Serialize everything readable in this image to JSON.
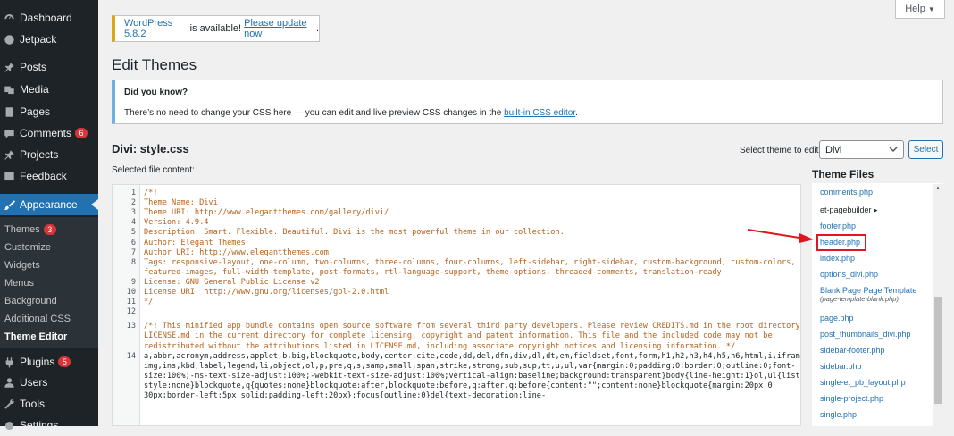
{
  "sidebar": {
    "items": [
      {
        "label": "Dashboard",
        "icon": "dashboard-icon"
      },
      {
        "label": "Jetpack",
        "icon": "jetpack-icon"
      },
      {
        "label": "Posts",
        "icon": "pin-icon"
      },
      {
        "label": "Media",
        "icon": "media-icon"
      },
      {
        "label": "Pages",
        "icon": "pages-icon"
      },
      {
        "label": "Comments",
        "icon": "comment-icon",
        "badge": "6"
      },
      {
        "label": "Projects",
        "icon": "pin-icon"
      },
      {
        "label": "Feedback",
        "icon": "feedback-icon"
      },
      {
        "label": "Appearance",
        "icon": "brush-icon"
      },
      {
        "label": "Plugins",
        "icon": "plugin-icon",
        "badge": "5"
      },
      {
        "label": "Users",
        "icon": "users-icon"
      },
      {
        "label": "Tools",
        "icon": "tools-icon"
      },
      {
        "label": "Settings",
        "icon": "settings-icon"
      }
    ],
    "submenu": [
      {
        "label": "Themes",
        "badge": "3"
      },
      {
        "label": "Customize"
      },
      {
        "label": "Widgets"
      },
      {
        "label": "Menus"
      },
      {
        "label": "Background"
      },
      {
        "label": "Additional CSS"
      },
      {
        "label": "Theme Editor"
      }
    ]
  },
  "help": {
    "label": "Help"
  },
  "notice": {
    "version_text": "WordPress 5.8.2",
    "is_available": " is available! ",
    "link": "Please update now",
    "end": "."
  },
  "page_title": "Edit Themes",
  "did_you_know": {
    "title": "Did you know?",
    "text": "There’s no need to change your CSS here — you can edit and live preview CSS changes in the ",
    "link": "built-in CSS editor",
    "end": "."
  },
  "file_title": "Divi: style.css",
  "selected_label": "Selected file content:",
  "theme_select": {
    "label": "Select theme to edit: ",
    "value": "Divi",
    "button": "Select"
  },
  "editor": {
    "lines": [
      {
        "n": "1",
        "text": "/*!"
      },
      {
        "n": "2",
        "text": "Theme Name: Divi"
      },
      {
        "n": "3",
        "text": "Theme URI: http://www.elegantthemes.com/gallery/divi/"
      },
      {
        "n": "4",
        "text": "Version: 4.9.4"
      },
      {
        "n": "5",
        "text": "Description: Smart. Flexible. Beautiful. Divi is the most powerful theme in our collection."
      },
      {
        "n": "6",
        "text": "Author: Elegant Themes"
      },
      {
        "n": "7",
        "text": "Author URI: http://www.elegantthemes.com"
      },
      {
        "n": "8",
        "text": "Tags: responsive-layout, one-column, two-columns, three-columns, four-columns, left-sidebar, right-sidebar, custom-background, custom-colors,"
      },
      {
        "n": "",
        "text": "featured-images, full-width-template, post-formats, rtl-language-support, theme-options, threaded-comments, translation-ready"
      },
      {
        "n": "9",
        "text": "License: GNU General Public License v2"
      },
      {
        "n": "10",
        "text": "License URI: http://www.gnu.org/licenses/gpl-2.0.html"
      },
      {
        "n": "11",
        "text": "*/"
      },
      {
        "n": "12",
        "text": ""
      },
      {
        "n": "13",
        "text": "/*! This minified app bundle contains open source software from several third party developers. Please review CREDITS.md in the root directory or"
      },
      {
        "n": "",
        "text": "LICENSE.md in the current directory for complete licensing, copyright and patent information. This file and the included code may not be"
      },
      {
        "n": "",
        "text": "redistributed without the attributions listed in LICENSE.md, including associate copyright notices and licensing information. */"
      },
      {
        "n": "14",
        "text": "a,abbr,acronym,address,applet,b,big,blockquote,body,center,cite,code,dd,del,dfn,div,dl,dt,em,fieldset,font,form,h1,h2,h3,h4,h5,h6,html,i,iframe,"
      },
      {
        "n": "",
        "text": "img,ins,kbd,label,legend,li,object,ol,p,pre,q,s,samp,small,span,strike,strong,sub,sup,tt,u,ul,var{margin:0;padding:0;border:0;outline:0;font-"
      },
      {
        "n": "",
        "text": "size:100%;-ms-text-size-adjust:100%;-webkit-text-size-adjust:100%;vertical-align:baseline;background:transparent}body{line-height:1}ol,ul{list-"
      },
      {
        "n": "",
        "text": "style:none}blockquote,q{quotes:none}blockquote:after,blockquote:before,q:after,q:before{content:\"\";content:none}blockquote{margin:20px 0"
      },
      {
        "n": "",
        "text": "30px;border-left:5px solid;padding-left:20px}:focus{outline:0}del{text-decoration:line-"
      }
    ]
  },
  "theme_files": {
    "title": "Theme Files",
    "items": [
      {
        "label": "comments.php"
      },
      {
        "label": "et-pagebuilder ▸"
      },
      {
        "label": "footer.php"
      },
      {
        "label": "header.php"
      },
      {
        "label": "index.php"
      },
      {
        "label": "options_divi.php"
      },
      {
        "label": "Blank Page Page Template",
        "sub": "(page-template-blank.php)"
      },
      {
        "label": "page.php"
      },
      {
        "label": "post_thumbnails_divi.php"
      },
      {
        "label": "sidebar-footer.php"
      },
      {
        "label": "sidebar.php"
      },
      {
        "label": "single-et_pb_layout.php"
      },
      {
        "label": "single-project.php"
      },
      {
        "label": "single.php"
      }
    ]
  }
}
